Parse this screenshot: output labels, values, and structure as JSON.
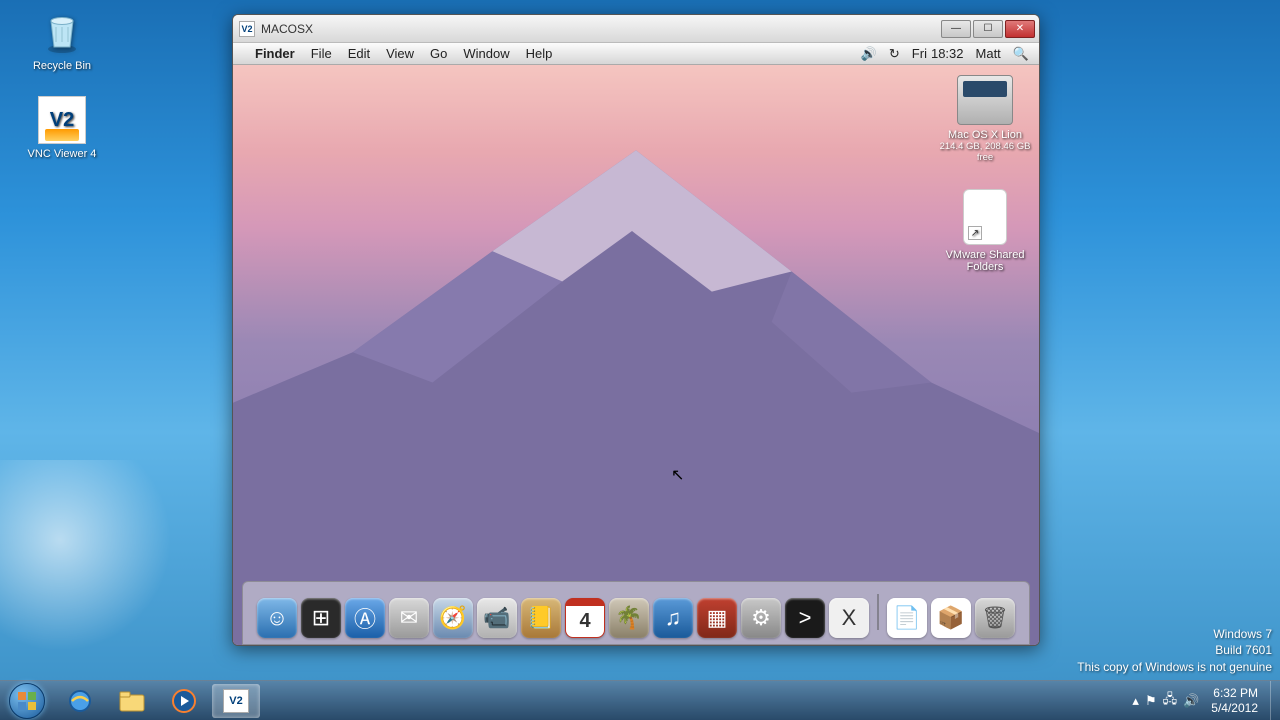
{
  "windows_desktop": {
    "icons": {
      "recycle_bin": "Recycle Bin",
      "vnc_viewer": "VNC Viewer 4"
    }
  },
  "vnc_window": {
    "title": "MACOSX",
    "app_badge": "V2"
  },
  "mac_menubar": {
    "app": "Finder",
    "items": [
      "File",
      "Edit",
      "View",
      "Go",
      "Window",
      "Help"
    ],
    "day": "Fri",
    "time": "18:32",
    "user": "Matt"
  },
  "mac_desktop_icons": {
    "hd": {
      "label": "Mac OS X Lion",
      "sub": "214.4 GB, 208.46 GB free"
    },
    "vmshared": {
      "label_line1": "VMware Shared",
      "label_line2": "Folders"
    }
  },
  "mac_dock": {
    "items": [
      {
        "name": "finder",
        "bg": "linear-gradient(to bottom,#7fb8e8,#2a6fb0)",
        "glyph": "☺"
      },
      {
        "name": "dashboard",
        "bg": "#2a2a2a",
        "glyph": "⊞"
      },
      {
        "name": "app-store",
        "bg": "linear-gradient(to bottom,#6aa8e8,#1a5fa8)",
        "glyph": "Ⓐ"
      },
      {
        "name": "mail",
        "bg": "linear-gradient(to bottom,#d8d8d8,#9a9a9a)",
        "glyph": "✉"
      },
      {
        "name": "safari",
        "bg": "linear-gradient(to bottom,#c8d8e8,#6a8ab0)",
        "glyph": "🧭"
      },
      {
        "name": "facetime",
        "bg": "linear-gradient(to bottom,#e8e8e8,#b0b0b0)",
        "glyph": "📹"
      },
      {
        "name": "contacts",
        "bg": "linear-gradient(to bottom,#d8b878,#a87838)",
        "glyph": "📒"
      },
      {
        "name": "calendar",
        "bg": "#fff",
        "glyph": "4"
      },
      {
        "name": "iphoto",
        "bg": "linear-gradient(to bottom,#d0c8b8,#8a8068)",
        "glyph": "🌴"
      },
      {
        "name": "itunes",
        "bg": "linear-gradient(to bottom,#5a9ad8,#1a5a9a)",
        "glyph": "♫"
      },
      {
        "name": "photo-booth",
        "bg": "linear-gradient(to bottom,#c04030,#802818)",
        "glyph": "▦"
      },
      {
        "name": "preferences",
        "bg": "linear-gradient(to bottom,#c8c8c8,#888)",
        "glyph": "⚙"
      },
      {
        "name": "terminal",
        "bg": "#1a1a1a",
        "glyph": ">"
      },
      {
        "name": "x11",
        "bg": "#f0f0f0",
        "glyph": "X"
      }
    ],
    "after_sep": [
      {
        "name": "document",
        "bg": "#fff",
        "glyph": "📄"
      },
      {
        "name": "zip",
        "bg": "#fff",
        "glyph": "📦"
      },
      {
        "name": "trash",
        "bg": "linear-gradient(to bottom,#d8d8d8,#9a9a9a)",
        "glyph": "🗑"
      }
    ]
  },
  "watermark": {
    "line1": "Windows 7",
    "line2": "Build 7601",
    "line3": "This copy of Windows is not genuine"
  },
  "taskbar": {
    "clock_time": "6:32 PM",
    "clock_date": "5/4/2012"
  }
}
